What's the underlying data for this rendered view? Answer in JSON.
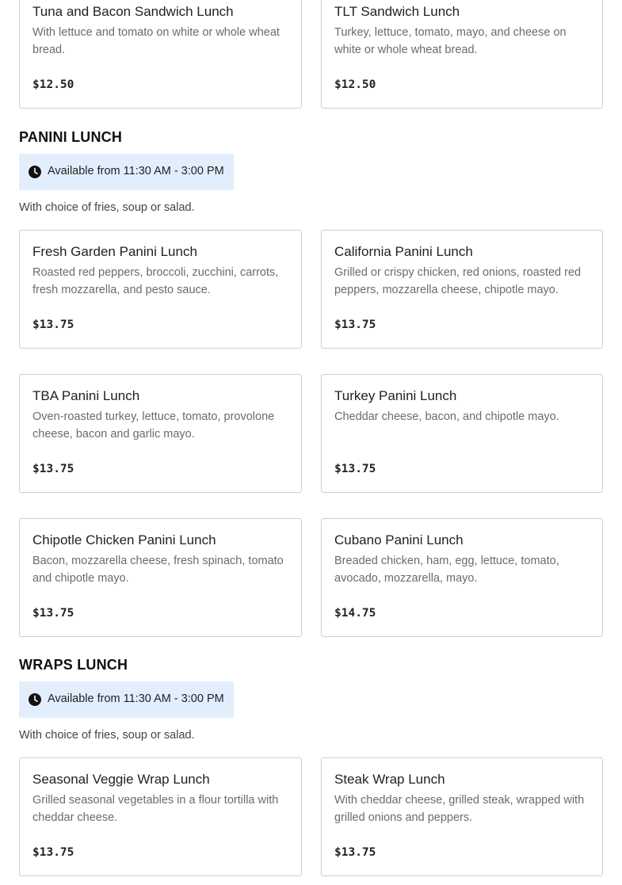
{
  "top_cards": [
    {
      "name": "Tuna and Bacon Sandwich Lunch",
      "description": "With lettuce and tomato on white or whole wheat bread.",
      "price": "$12.50"
    },
    {
      "name": "TLT Sandwich Lunch",
      "description": "Turkey, lettuce, tomato, mayo, and cheese on white or whole wheat bread.",
      "price": "$12.50"
    }
  ],
  "panini": {
    "title": "PANINI LUNCH",
    "availability": "Available from 11:30 AM - 3:00 PM",
    "note": "With choice of fries, soup or salad.",
    "items": [
      {
        "name": "Fresh Garden Panini Lunch",
        "description": "Roasted red peppers, broccoli, zucchini, carrots, fresh mozzarella, and pesto sauce.",
        "price": "$13.75"
      },
      {
        "name": "California Panini Lunch",
        "description": "Grilled or crispy chicken, red onions, roasted red peppers, mozzarella cheese, chipotle mayo.",
        "price": "$13.75"
      },
      {
        "name": "TBA Panini Lunch",
        "description": "Oven-roasted turkey, lettuce, tomato, provolone cheese, bacon and garlic mayo.",
        "price": "$13.75"
      },
      {
        "name": "Turkey Panini Lunch",
        "description": "Cheddar cheese, bacon, and chipotle mayo.",
        "price": "$13.75"
      },
      {
        "name": "Chipotle Chicken Panini Lunch",
        "description": "Bacon, mozzarella cheese, fresh spinach, tomato and chipotle mayo.",
        "price": "$13.75"
      },
      {
        "name": "Cubano Panini Lunch",
        "description": "Breaded chicken, ham, egg, lettuce, tomato, avocado, mozzarella, mayo.",
        "price": "$14.75"
      }
    ]
  },
  "wraps": {
    "title": "WRAPS LUNCH",
    "availability": "Available from 11:30 AM - 3:00 PM",
    "note": "With choice of fries, soup or salad.",
    "items": [
      {
        "name": "Seasonal Veggie Wrap Lunch",
        "description": "Grilled seasonal vegetables in a flour tortilla with cheddar cheese.",
        "price": "$13.75"
      },
      {
        "name": "Steak Wrap Lunch",
        "description": "With cheddar cheese, grilled steak, wrapped with grilled onions and peppers.",
        "price": "$13.75"
      }
    ]
  },
  "icons": {
    "availability_icon": "clock-icon"
  },
  "colors": {
    "availability_bg": "#e3eefd",
    "card_border": "#cfcfcf"
  }
}
